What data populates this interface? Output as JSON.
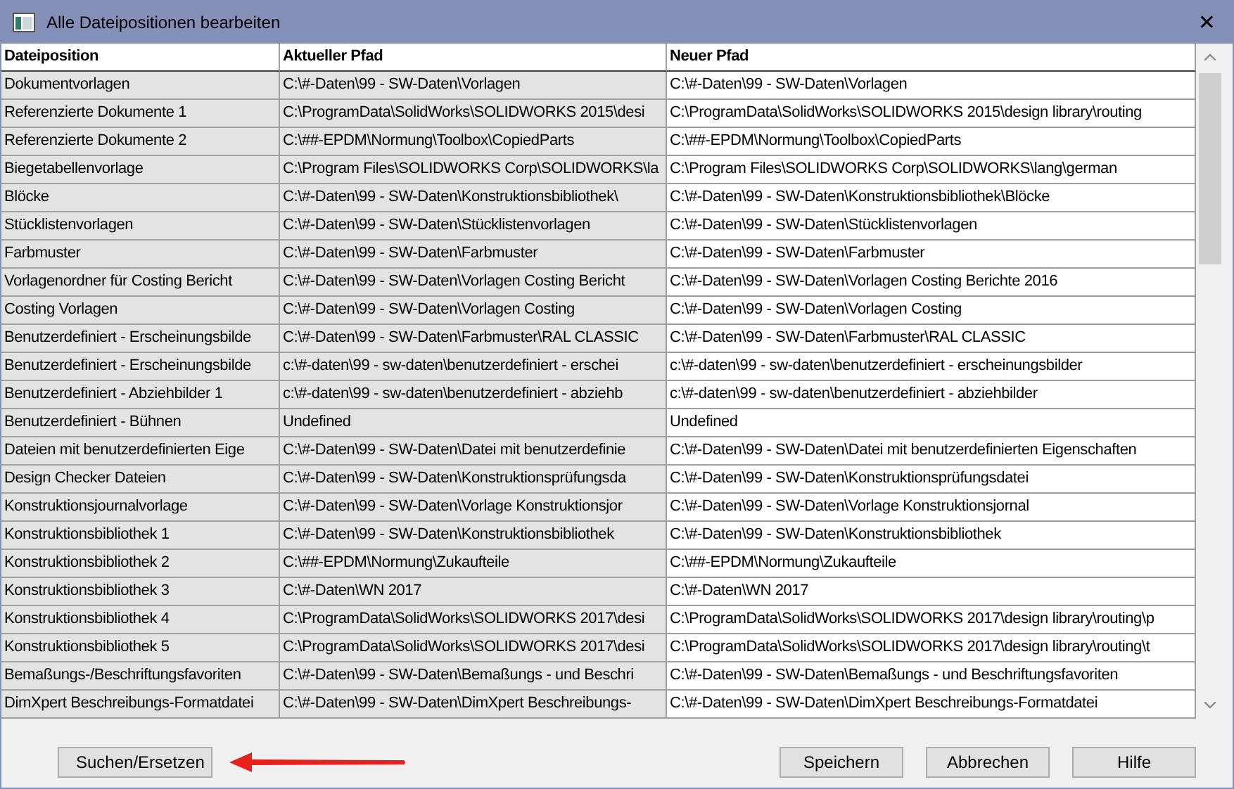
{
  "window": {
    "title": "Alle Dateipositionen bearbeiten",
    "close": "✕"
  },
  "table": {
    "columns": [
      "Dateiposition",
      "Aktueller Pfad",
      "Neuer Pfad"
    ],
    "rows": [
      [
        "Dokumentvorlagen",
        "C:\\#-Daten\\99 - SW-Daten\\Vorlagen",
        "C:\\#-Daten\\99 - SW-Daten\\Vorlagen"
      ],
      [
        "Referenzierte Dokumente 1",
        "C:\\ProgramData\\SolidWorks\\SOLIDWORKS 2015\\desi",
        "C:\\ProgramData\\SolidWorks\\SOLIDWORKS 2015\\design library\\routing"
      ],
      [
        "Referenzierte Dokumente 2",
        "C:\\##-EPDM\\Normung\\Toolbox\\CopiedParts",
        "C:\\##-EPDM\\Normung\\Toolbox\\CopiedParts"
      ],
      [
        "Biegetabellenvorlage",
        "C:\\Program Files\\SOLIDWORKS Corp\\SOLIDWORKS\\la",
        "C:\\Program Files\\SOLIDWORKS Corp\\SOLIDWORKS\\lang\\german"
      ],
      [
        "Blöcke",
        "C:\\#-Daten\\99 - SW-Daten\\Konstruktionsbibliothek\\",
        "C:\\#-Daten\\99 - SW-Daten\\Konstruktionsbibliothek\\Blöcke"
      ],
      [
        "Stücklistenvorlagen",
        "C:\\#-Daten\\99 - SW-Daten\\Stücklistenvorlagen",
        "C:\\#-Daten\\99 - SW-Daten\\Stücklistenvorlagen"
      ],
      [
        "Farbmuster",
        "C:\\#-Daten\\99 - SW-Daten\\Farbmuster",
        "C:\\#-Daten\\99 - SW-Daten\\Farbmuster"
      ],
      [
        "Vorlagenordner für Costing Bericht",
        "C:\\#-Daten\\99 - SW-Daten\\Vorlagen Costing Bericht",
        "C:\\#-Daten\\99 - SW-Daten\\Vorlagen Costing Berichte 2016"
      ],
      [
        "Costing Vorlagen",
        "C:\\#-Daten\\99 - SW-Daten\\Vorlagen Costing",
        "C:\\#-Daten\\99 - SW-Daten\\Vorlagen Costing"
      ],
      [
        "Benutzerdefiniert - Erscheinungsbilde",
        "C:\\#-Daten\\99 - SW-Daten\\Farbmuster\\RAL CLASSIC",
        "C:\\#-Daten\\99 - SW-Daten\\Farbmuster\\RAL CLASSIC"
      ],
      [
        "Benutzerdefiniert - Erscheinungsbilde",
        "c:\\#-daten\\99 - sw-daten\\benutzerdefiniert - erschei",
        "c:\\#-daten\\99 - sw-daten\\benutzerdefiniert - erscheinungsbilder"
      ],
      [
        "Benutzerdefiniert - Abziehbilder 1",
        "c:\\#-daten\\99 - sw-daten\\benutzerdefiniert - abziehb",
        "c:\\#-daten\\99 - sw-daten\\benutzerdefiniert - abziehbilder"
      ],
      [
        "Benutzerdefiniert -  Bühnen",
        "Undefined",
        "Undefined"
      ],
      [
        "Dateien mit benutzerdefinierten Eige",
        "C:\\#-Daten\\99 - SW-Daten\\Datei mit benutzerdefinie",
        "C:\\#-Daten\\99 - SW-Daten\\Datei mit benutzerdefinierten Eigenschaften"
      ],
      [
        "Design Checker Dateien",
        "C:\\#-Daten\\99 - SW-Daten\\Konstruktionsprüfungsda",
        "C:\\#-Daten\\99 - SW-Daten\\Konstruktionsprüfungsdatei"
      ],
      [
        "Konstruktionsjournalvorlage",
        "C:\\#-Daten\\99 - SW-Daten\\Vorlage Konstruktionsjor",
        "C:\\#-Daten\\99 - SW-Daten\\Vorlage Konstruktionsjornal"
      ],
      [
        "Konstruktionsbibliothek 1",
        "C:\\#-Daten\\99 - SW-Daten\\Konstruktionsbibliothek",
        "C:\\#-Daten\\99 - SW-Daten\\Konstruktionsbibliothek"
      ],
      [
        "Konstruktionsbibliothek 2",
        "C:\\##-EPDM\\Normung\\Zukaufteile",
        "C:\\##-EPDM\\Normung\\Zukaufteile"
      ],
      [
        "Konstruktionsbibliothek 3",
        "C:\\#-Daten\\WN 2017",
        "C:\\#-Daten\\WN 2017"
      ],
      [
        "Konstruktionsbibliothek 4",
        "C:\\ProgramData\\SolidWorks\\SOLIDWORKS 2017\\desi",
        "C:\\ProgramData\\SolidWorks\\SOLIDWORKS 2017\\design library\\routing\\p"
      ],
      [
        "Konstruktionsbibliothek 5",
        "C:\\ProgramData\\SolidWorks\\SOLIDWORKS 2017\\desi",
        "C:\\ProgramData\\SolidWorks\\SOLIDWORKS 2017\\design library\\routing\\t"
      ],
      [
        "Bemaßungs-/Beschriftungsfavoriten",
        "C:\\#-Daten\\99 - SW-Daten\\Bemaßungs - und Beschri",
        "C:\\#-Daten\\99 - SW-Daten\\Bemaßungs - und Beschriftungsfavoriten"
      ],
      [
        "DimXpert Beschreibungs-Formatdatei",
        "C:\\#-Daten\\99 - SW-Daten\\DimXpert Beschreibungs-",
        "C:\\#-Daten\\99 - SW-Daten\\DimXpert Beschreibungs-Formatdatei"
      ]
    ]
  },
  "buttons": {
    "left": [
      "Suchen/Ersetzen"
    ],
    "right": [
      "Speichern",
      "Abbrechen",
      "Hilfe"
    ]
  }
}
